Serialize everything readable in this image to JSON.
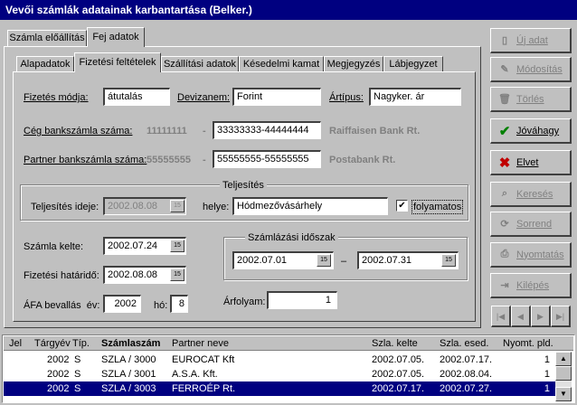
{
  "window": {
    "title": "Vevői számlák adatainak karbantartása (Belker.)"
  },
  "main_tabs": [
    {
      "label": "Számla előállítás"
    },
    {
      "label": "Fej adatok"
    }
  ],
  "sub_tabs": [
    {
      "label": "Alapadatok"
    },
    {
      "label": "Fizetési feltételek"
    },
    {
      "label": "Szállítási adatok"
    },
    {
      "label": "Késedelmi kamat"
    },
    {
      "label": "Megjegyzés"
    },
    {
      "label": "Lábjegyzet"
    }
  ],
  "form": {
    "fizetes_modja_label": "Fizetés módja:",
    "fizetes_modja_value": "átutalás",
    "devizanem_label": "Devizanem:",
    "devizanem_value": "Forint",
    "artipus_label": "Ártípus:",
    "artipus_value": "Nagyker. ár",
    "ceg_bank_label": "Cég bankszámla száma:",
    "ceg_bank_prefix": "11111111",
    "ceg_bank_dash": "-",
    "ceg_bank_value": "33333333-44444444",
    "ceg_bank_name": "Raiffaisen Bank Rt.",
    "partner_bank_label": "Partner bankszámla száma:",
    "partner_bank_prefix": "55555555",
    "partner_bank_dash": "-",
    "partner_bank_value": "55555555-55555555",
    "partner_bank_name": "Postabank Rt."
  },
  "teljesites": {
    "group_title": "Teljesítés",
    "ideje_label": "Teljesítés ideje:",
    "ideje_value": "2002.08.08",
    "helye_label": "helye:",
    "helye_value": "Hódmezővásárhely",
    "folyamatos_label": "folyamatos",
    "folyamatos_checked": "✔"
  },
  "dates": {
    "kelte_label": "Számla kelte:",
    "kelte_value": "2002.07.24",
    "hatarido_label": "Fizetési határidő:",
    "hatarido_value": "2002.08.08",
    "afa_label": "ÁFA bevallás  év:",
    "afa_year": "2002",
    "afa_ho_label": "hó:",
    "afa_month": "8"
  },
  "szamlazasi": {
    "group_title": "Számlázási időszak",
    "from": "2002.07.01",
    "dash": "–",
    "to": "2002.07.31",
    "arfolyam_label": "Árfolyam:",
    "arfolyam_value": "1"
  },
  "cal_glyph": "15",
  "buttons": [
    {
      "label": "Új adat",
      "icon": "new-doc-icon",
      "glyph": "▯",
      "disabled": true
    },
    {
      "label": "Módosítás",
      "icon": "edit-icon",
      "glyph": "✎",
      "disabled": true
    },
    {
      "label": "Törlés",
      "icon": "trash-icon",
      "glyph": "🗑",
      "disabled": true
    },
    {
      "label": "Jóváhagy",
      "icon": "check-icon",
      "glyph": "✔",
      "disabled": false
    },
    {
      "label": "Elvet",
      "icon": "x-icon",
      "glyph": "✖",
      "disabled": false
    },
    {
      "label": "Keresés",
      "icon": "search-icon",
      "glyph": "⌕",
      "disabled": true
    },
    {
      "label": "Sorrend",
      "icon": "sort-icon",
      "glyph": "⟳",
      "disabled": true
    },
    {
      "label": "Nyomtatás",
      "icon": "printer-icon",
      "glyph": "⎙",
      "disabled": true
    },
    {
      "label": "Kilépés",
      "icon": "exit-icon",
      "glyph": "⇥",
      "disabled": true
    }
  ],
  "nav": [
    {
      "glyph": "|◀",
      "icon": "first-record-icon"
    },
    {
      "glyph": "◀",
      "icon": "prev-record-icon"
    },
    {
      "glyph": "▶",
      "icon": "next-record-icon"
    },
    {
      "glyph": "▶|",
      "icon": "last-record-icon"
    }
  ],
  "grid": {
    "columns": [
      "Jel",
      "Tárgyév",
      "Típ.",
      "Számlaszám",
      "Partner neve",
      "Szla. kelte",
      "Szla. esed.",
      "Nyomt. pld."
    ],
    "rows": [
      {
        "jel": "",
        "targyev": "2002",
        "tip": "S",
        "szamlaszam": "SZLA / 3000",
        "partner": "EUROCAT Kft",
        "kelte": "2002.07.05.",
        "esed": "2002.07.17.",
        "pld": "1",
        "selected": false
      },
      {
        "jel": "",
        "targyev": "2002",
        "tip": "S",
        "szamlaszam": "SZLA / 3001",
        "partner": "A.S.A. Kft.",
        "kelte": "2002.07.05.",
        "esed": "2002.08.04.",
        "pld": "1",
        "selected": false
      },
      {
        "jel": "",
        "targyev": "2002",
        "tip": "S",
        "szamlaszam": "SZLA / 3003",
        "partner": "FERROÉP Rt.",
        "kelte": "2002.07.17.",
        "esed": "2002.07.27.",
        "pld": "1",
        "selected": true
      }
    ]
  },
  "scrollbar": {
    "up": "▲",
    "down": "▼"
  }
}
